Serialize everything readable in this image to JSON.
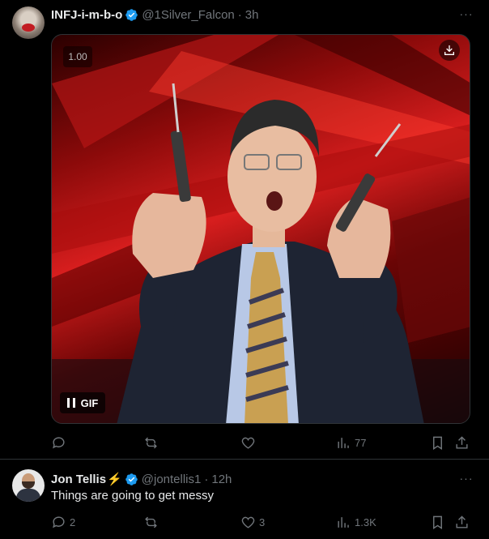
{
  "tweets": [
    {
      "author_name": "INFJ-i-m-b-o",
      "handle": "@1Silver_Falcon",
      "separator": "·",
      "time": "3h",
      "verified": true,
      "media": {
        "type": "GIF",
        "gif_label": "GIF",
        "speed": "1.00",
        "icons": [
          "download-icon",
          "pause-icon"
        ]
      },
      "actions": {
        "reply_count": "",
        "retweet_count": "",
        "like_count": "",
        "views_count": "77"
      }
    },
    {
      "author_name": "Jon Tellis",
      "name_emoji": "⚡",
      "handle": "@jontellis1",
      "separator": "·",
      "time": "12h",
      "verified": true,
      "text": "Things are going to get messy",
      "actions": {
        "reply_count": "2",
        "retweet_count": "",
        "like_count": "3",
        "views_count": "1.3K"
      }
    }
  ],
  "more_glyph": "···",
  "colors": {
    "background": "#000000",
    "text_primary": "#e7e9ea",
    "text_secondary": "#71767b",
    "verified_blue": "#1d9bf0",
    "divider": "#2f3336"
  }
}
